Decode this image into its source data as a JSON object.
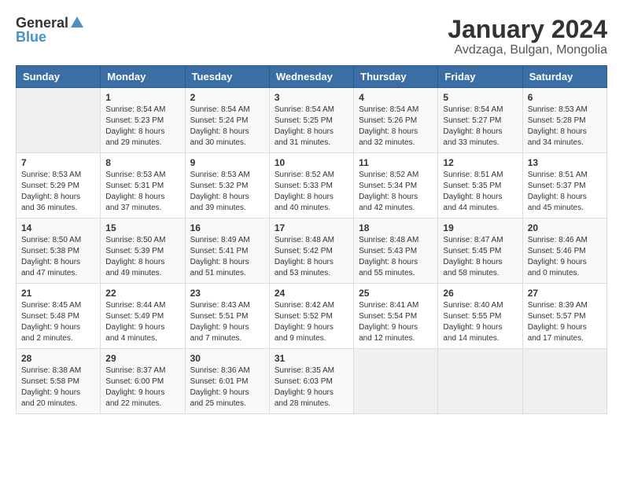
{
  "header": {
    "logo": {
      "general": "General",
      "blue": "Blue"
    },
    "title": "January 2024",
    "subtitle": "Avdzaga, Bulgan, Mongolia"
  },
  "calendar": {
    "days_of_week": [
      "Sunday",
      "Monday",
      "Tuesday",
      "Wednesday",
      "Thursday",
      "Friday",
      "Saturday"
    ],
    "weeks": [
      [
        {
          "day": "",
          "info": ""
        },
        {
          "day": "1",
          "sunrise": "Sunrise: 8:54 AM",
          "sunset": "Sunset: 5:23 PM",
          "daylight": "Daylight: 8 hours and 29 minutes."
        },
        {
          "day": "2",
          "sunrise": "Sunrise: 8:54 AM",
          "sunset": "Sunset: 5:24 PM",
          "daylight": "Daylight: 8 hours and 30 minutes."
        },
        {
          "day": "3",
          "sunrise": "Sunrise: 8:54 AM",
          "sunset": "Sunset: 5:25 PM",
          "daylight": "Daylight: 8 hours and 31 minutes."
        },
        {
          "day": "4",
          "sunrise": "Sunrise: 8:54 AM",
          "sunset": "Sunset: 5:26 PM",
          "daylight": "Daylight: 8 hours and 32 minutes."
        },
        {
          "day": "5",
          "sunrise": "Sunrise: 8:54 AM",
          "sunset": "Sunset: 5:27 PM",
          "daylight": "Daylight: 8 hours and 33 minutes."
        },
        {
          "day": "6",
          "sunrise": "Sunrise: 8:53 AM",
          "sunset": "Sunset: 5:28 PM",
          "daylight": "Daylight: 8 hours and 34 minutes."
        }
      ],
      [
        {
          "day": "7",
          "sunrise": "Sunrise: 8:53 AM",
          "sunset": "Sunset: 5:29 PM",
          "daylight": "Daylight: 8 hours and 36 minutes."
        },
        {
          "day": "8",
          "sunrise": "Sunrise: 8:53 AM",
          "sunset": "Sunset: 5:31 PM",
          "daylight": "Daylight: 8 hours and 37 minutes."
        },
        {
          "day": "9",
          "sunrise": "Sunrise: 8:53 AM",
          "sunset": "Sunset: 5:32 PM",
          "daylight": "Daylight: 8 hours and 39 minutes."
        },
        {
          "day": "10",
          "sunrise": "Sunrise: 8:52 AM",
          "sunset": "Sunset: 5:33 PM",
          "daylight": "Daylight: 8 hours and 40 minutes."
        },
        {
          "day": "11",
          "sunrise": "Sunrise: 8:52 AM",
          "sunset": "Sunset: 5:34 PM",
          "daylight": "Daylight: 8 hours and 42 minutes."
        },
        {
          "day": "12",
          "sunrise": "Sunrise: 8:51 AM",
          "sunset": "Sunset: 5:35 PM",
          "daylight": "Daylight: 8 hours and 44 minutes."
        },
        {
          "day": "13",
          "sunrise": "Sunrise: 8:51 AM",
          "sunset": "Sunset: 5:37 PM",
          "daylight": "Daylight: 8 hours and 45 minutes."
        }
      ],
      [
        {
          "day": "14",
          "sunrise": "Sunrise: 8:50 AM",
          "sunset": "Sunset: 5:38 PM",
          "daylight": "Daylight: 8 hours and 47 minutes."
        },
        {
          "day": "15",
          "sunrise": "Sunrise: 8:50 AM",
          "sunset": "Sunset: 5:39 PM",
          "daylight": "Daylight: 8 hours and 49 minutes."
        },
        {
          "day": "16",
          "sunrise": "Sunrise: 8:49 AM",
          "sunset": "Sunset: 5:41 PM",
          "daylight": "Daylight: 8 hours and 51 minutes."
        },
        {
          "day": "17",
          "sunrise": "Sunrise: 8:48 AM",
          "sunset": "Sunset: 5:42 PM",
          "daylight": "Daylight: 8 hours and 53 minutes."
        },
        {
          "day": "18",
          "sunrise": "Sunrise: 8:48 AM",
          "sunset": "Sunset: 5:43 PM",
          "daylight": "Daylight: 8 hours and 55 minutes."
        },
        {
          "day": "19",
          "sunrise": "Sunrise: 8:47 AM",
          "sunset": "Sunset: 5:45 PM",
          "daylight": "Daylight: 8 hours and 58 minutes."
        },
        {
          "day": "20",
          "sunrise": "Sunrise: 8:46 AM",
          "sunset": "Sunset: 5:46 PM",
          "daylight": "Daylight: 9 hours and 0 minutes."
        }
      ],
      [
        {
          "day": "21",
          "sunrise": "Sunrise: 8:45 AM",
          "sunset": "Sunset: 5:48 PM",
          "daylight": "Daylight: 9 hours and 2 minutes."
        },
        {
          "day": "22",
          "sunrise": "Sunrise: 8:44 AM",
          "sunset": "Sunset: 5:49 PM",
          "daylight": "Daylight: 9 hours and 4 minutes."
        },
        {
          "day": "23",
          "sunrise": "Sunrise: 8:43 AM",
          "sunset": "Sunset: 5:51 PM",
          "daylight": "Daylight: 9 hours and 7 minutes."
        },
        {
          "day": "24",
          "sunrise": "Sunrise: 8:42 AM",
          "sunset": "Sunset: 5:52 PM",
          "daylight": "Daylight: 9 hours and 9 minutes."
        },
        {
          "day": "25",
          "sunrise": "Sunrise: 8:41 AM",
          "sunset": "Sunset: 5:54 PM",
          "daylight": "Daylight: 9 hours and 12 minutes."
        },
        {
          "day": "26",
          "sunrise": "Sunrise: 8:40 AM",
          "sunset": "Sunset: 5:55 PM",
          "daylight": "Daylight: 9 hours and 14 minutes."
        },
        {
          "day": "27",
          "sunrise": "Sunrise: 8:39 AM",
          "sunset": "Sunset: 5:57 PM",
          "daylight": "Daylight: 9 hours and 17 minutes."
        }
      ],
      [
        {
          "day": "28",
          "sunrise": "Sunrise: 8:38 AM",
          "sunset": "Sunset: 5:58 PM",
          "daylight": "Daylight: 9 hours and 20 minutes."
        },
        {
          "day": "29",
          "sunrise": "Sunrise: 8:37 AM",
          "sunset": "Sunset: 6:00 PM",
          "daylight": "Daylight: 9 hours and 22 minutes."
        },
        {
          "day": "30",
          "sunrise": "Sunrise: 8:36 AM",
          "sunset": "Sunset: 6:01 PM",
          "daylight": "Daylight: 9 hours and 25 minutes."
        },
        {
          "day": "31",
          "sunrise": "Sunrise: 8:35 AM",
          "sunset": "Sunset: 6:03 PM",
          "daylight": "Daylight: 9 hours and 28 minutes."
        },
        {
          "day": "",
          "info": ""
        },
        {
          "day": "",
          "info": ""
        },
        {
          "day": "",
          "info": ""
        }
      ]
    ]
  }
}
